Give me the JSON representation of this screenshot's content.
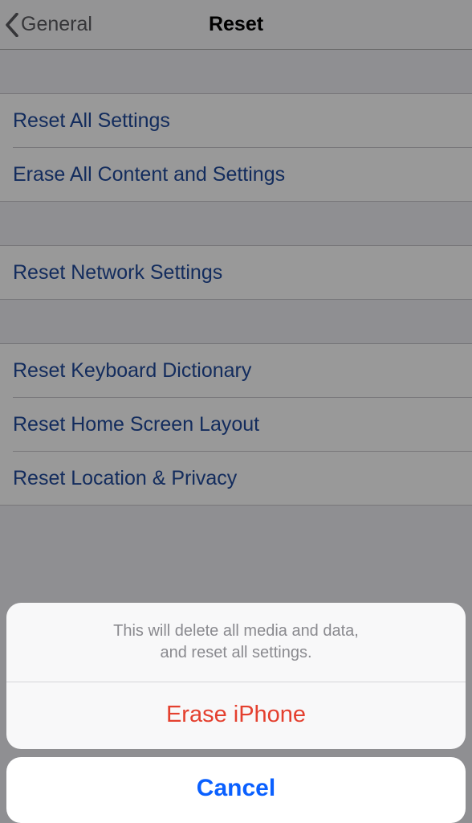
{
  "nav": {
    "back_label": "General",
    "title": "Reset"
  },
  "groups": [
    {
      "items": [
        "Reset All Settings",
        "Erase All Content and Settings"
      ]
    },
    {
      "items": [
        "Reset Network Settings"
      ]
    },
    {
      "items": [
        "Reset Keyboard Dictionary",
        "Reset Home Screen Layout",
        "Reset Location & Privacy"
      ]
    }
  ],
  "sheet": {
    "message_line1": "This will delete all media and data,",
    "message_line2": "and reset all settings.",
    "destructive_label": "Erase iPhone",
    "cancel_label": "Cancel"
  }
}
